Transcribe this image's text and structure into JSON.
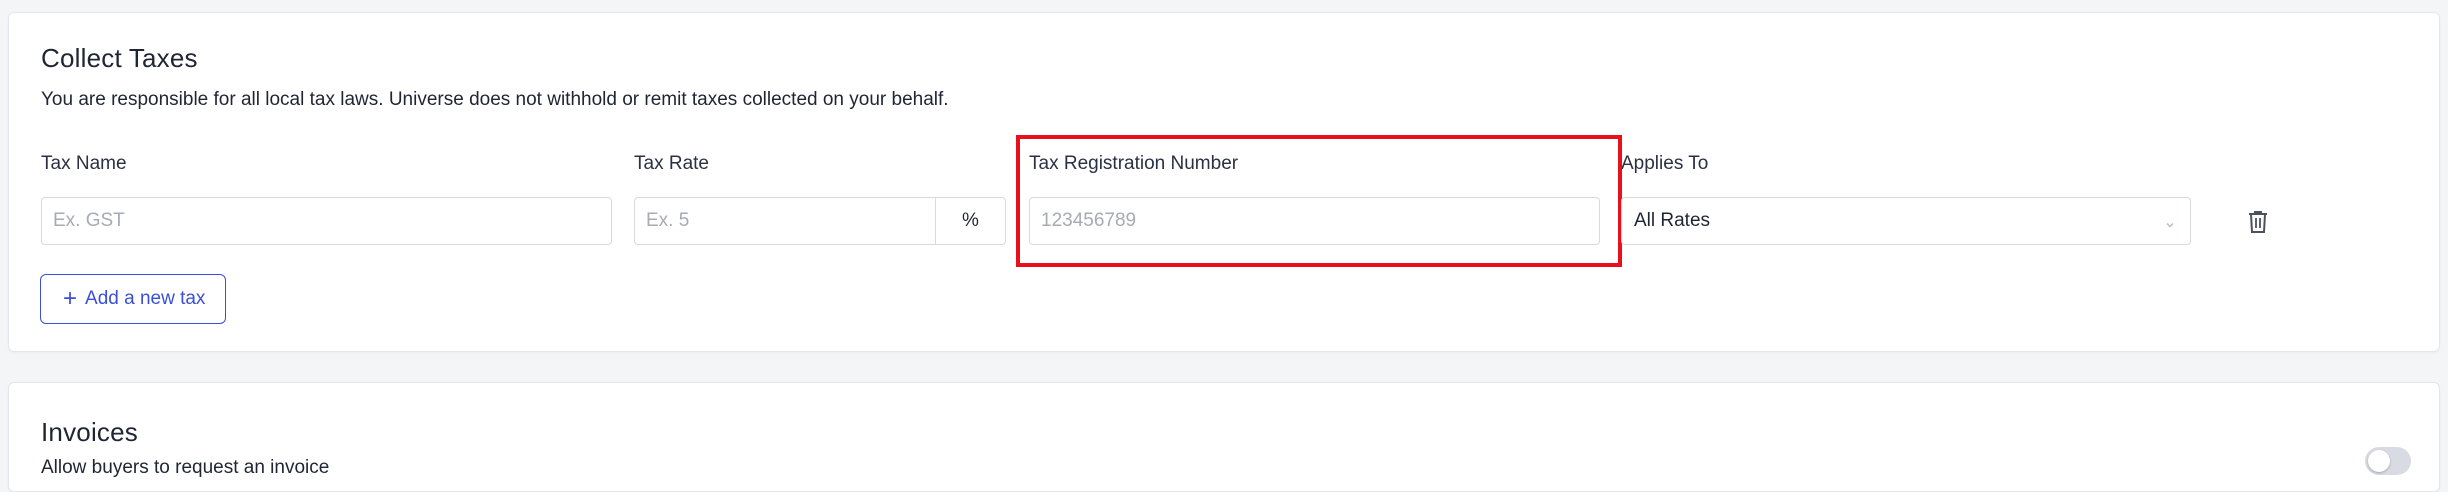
{
  "collect_taxes": {
    "title": "Collect Taxes",
    "description": "You are responsible for all local tax laws. Universe does not withhold or remit taxes collected on your behalf.",
    "fields": {
      "tax_name": {
        "label": "Tax Name",
        "placeholder": "Ex. GST",
        "value": ""
      },
      "tax_rate": {
        "label": "Tax Rate",
        "placeholder": "Ex. 5",
        "value": "",
        "suffix": "%"
      },
      "tax_registration_number": {
        "label": "Tax Registration Number",
        "placeholder": "123456789",
        "value": ""
      },
      "applies_to": {
        "label": "Applies To",
        "selected": "All Rates"
      }
    },
    "delete_icon": "trash-icon",
    "add_button_label": "Add a new tax",
    "add_button_icon": "plus-icon",
    "highlight_color": "#e8101a",
    "accent_color": "#3b4fd8"
  },
  "invoices": {
    "title": "Invoices",
    "description": "Allow buyers to request an invoice",
    "toggle_on": false
  }
}
